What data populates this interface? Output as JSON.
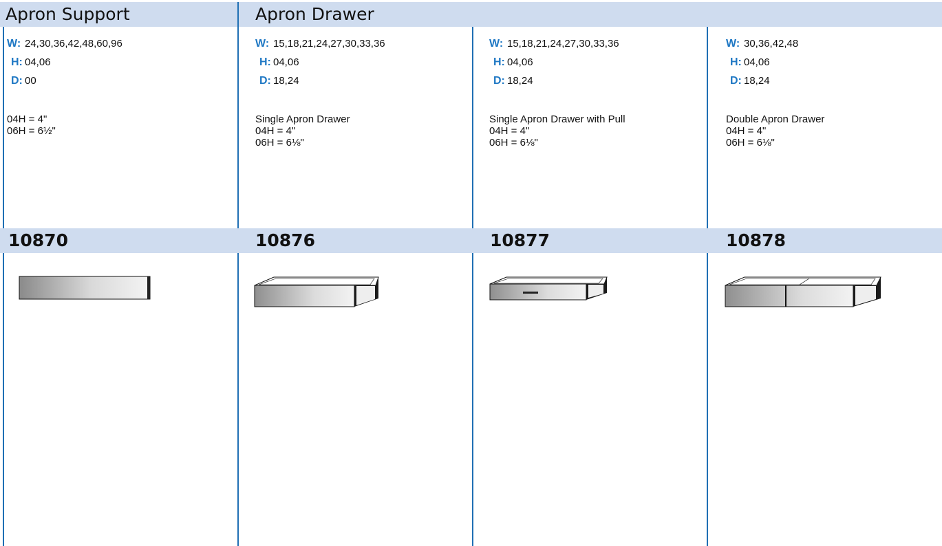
{
  "sections": {
    "support_title": "Apron Support",
    "drawer_title": "Apron Drawer"
  },
  "labels": {
    "w": "W:",
    "h": "H:",
    "d": "D:"
  },
  "columns": [
    {
      "w": "24,30,36,42,48,60,96",
      "h": "04,06",
      "d": "00",
      "notes": [
        "04H = 4\"",
        "06H = 6½\""
      ],
      "code": "10870",
      "illustration": "apron-support-panel"
    },
    {
      "w": "15,18,21,24,27,30,33,36",
      "h": "04,06",
      "d": "18,24",
      "notes": [
        "Single Apron Drawer",
        "04H = 4\"",
        "06H = 6⅛\""
      ],
      "code": "10876",
      "illustration": "single-apron-drawer"
    },
    {
      "w": "15,18,21,24,27,30,33,36",
      "h": "04,06",
      "d": "18,24",
      "notes": [
        "Single Apron Drawer with Pull",
        "04H = 4\"",
        "06H = 6⅛\""
      ],
      "code": "10877",
      "illustration": "single-apron-drawer-with-pull"
    },
    {
      "w": "30,36,42,48",
      "h": "04,06",
      "d": "18,24",
      "notes": [
        "Double Apron Drawer",
        "04H = 4\"",
        "06H = 6⅛\""
      ],
      "code": "10878",
      "illustration": "double-apron-drawer"
    }
  ],
  "colors": {
    "band": "#cfdcef",
    "divider": "#1f6fb4",
    "label_blue": "#1f78c4"
  }
}
